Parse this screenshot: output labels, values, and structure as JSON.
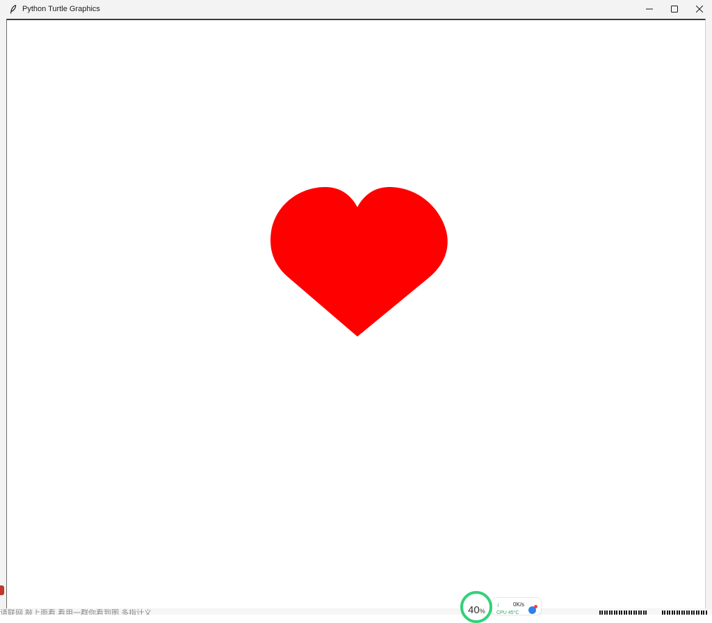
{
  "window": {
    "title": "Python Turtle Graphics",
    "icon": "feather-icon"
  },
  "controls": {
    "minimize": "minimize-icon",
    "maximize": "maximize-icon",
    "close": "close-icon"
  },
  "canvas": {
    "background": "#ffffff",
    "shape": "heart",
    "fill_color": "#ff0000"
  },
  "taskbar": {
    "partial_text": "请联网,敲上面看,看用一群你看到图,多指计义",
    "perf": {
      "percent": "40",
      "percent_unit": "%",
      "net_speed": "0K/s",
      "cpu_label": "CPU 45°C"
    }
  }
}
